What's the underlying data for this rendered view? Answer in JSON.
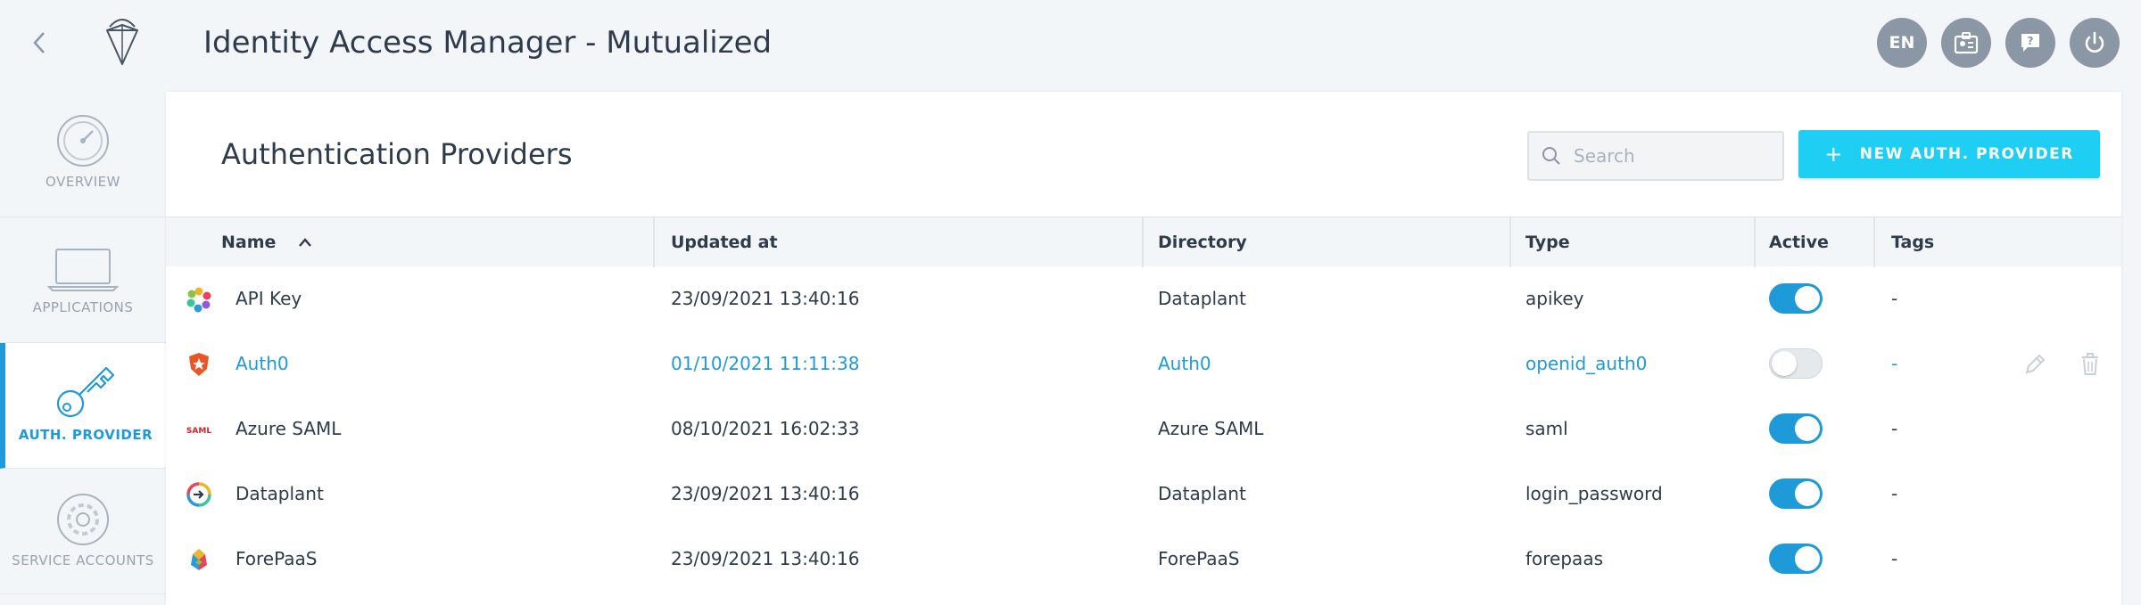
{
  "header": {
    "title": "Identity Access Manager - Mutualized",
    "lang": "EN",
    "icons": [
      "back-arrow-icon",
      "logo-icon",
      "badge-icon",
      "help-icon",
      "power-icon"
    ]
  },
  "sidebar": {
    "items": [
      {
        "label": "OVERVIEW",
        "icon": "speedometer-icon"
      },
      {
        "label": "APPLICATIONS",
        "icon": "laptop-icon"
      },
      {
        "label": "AUTH. PROVIDER",
        "icon": "key-icon",
        "active": true
      },
      {
        "label": "SERVICE ACCOUNTS",
        "icon": "gear-icon"
      }
    ]
  },
  "main": {
    "title": "Authentication Providers",
    "search_placeholder": "Search",
    "new_button_label": "NEW AUTH. PROVIDER",
    "columns": {
      "name": "Name",
      "updated_at": "Updated at",
      "directory": "Directory",
      "type": "Type",
      "active": "Active",
      "tags": "Tags"
    },
    "rows": [
      {
        "name": "API Key",
        "updated_at": "23/09/2021 13:40:16",
        "directory": "Dataplant",
        "type": "apikey",
        "active": true,
        "tags": "-",
        "icon": "apikey-logo-icon"
      },
      {
        "name": "Auth0",
        "updated_at": "01/10/2021 11:11:38",
        "directory": "Auth0",
        "type": "openid_auth0",
        "active": false,
        "tags": "-",
        "icon": "auth0-logo-icon"
      },
      {
        "name": "Azure SAML",
        "updated_at": "08/10/2021 16:02:33",
        "directory": "Azure SAML",
        "type": "saml",
        "active": true,
        "tags": "-",
        "icon": "saml-logo-icon",
        "icon_text": "SAML"
      },
      {
        "name": "Dataplant",
        "updated_at": "23/09/2021 13:40:16",
        "directory": "Dataplant",
        "type": "login_password",
        "active": true,
        "tags": "-",
        "icon": "dataplant-logo-icon"
      },
      {
        "name": "ForePaaS",
        "updated_at": "23/09/2021 13:40:16",
        "directory": "ForePaaS",
        "type": "forepaas",
        "active": true,
        "tags": "-",
        "icon": "forepaas-logo-icon"
      }
    ]
  },
  "colors": {
    "accent": "#1f9ad8",
    "button": "#1ecff3",
    "header_btn": "#8b97a5",
    "toggle_off": "#e6e9ec"
  }
}
